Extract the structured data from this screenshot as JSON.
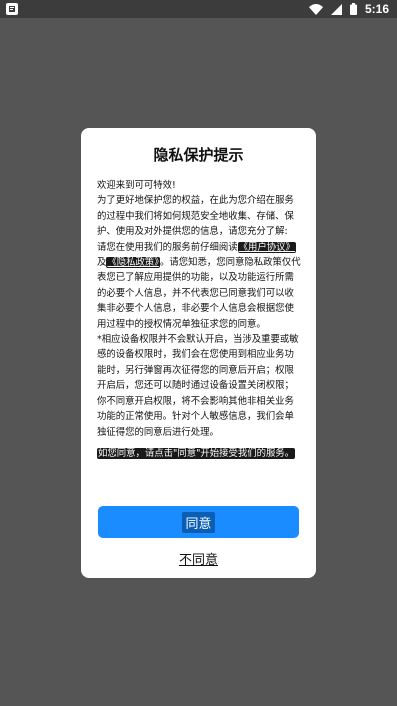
{
  "status_bar": {
    "time": "5:16",
    "icons": [
      "app-notification-icon",
      "wifi-icon",
      "cellular-signal-icon",
      "battery-icon"
    ]
  },
  "dialog": {
    "title": "隐私保护提示",
    "greeting": "欢迎来到可可特效!",
    "para1": "为了更好地保护您的权益，在此为您介绍在服务的过程中我们将如何规范安全地收集、存储、保护、使用及对外提供您的信息，请您充分了解:",
    "para2_prefix": "请您在使用我们的服务前仔细阅读",
    "user_agreement_link": "《用户协议》",
    "para2_and": "及",
    "privacy_policy_link": "《隐私政策》",
    "para2_suffix": "。请您知悉，您同意隐私政策仅代表您已了解应用提供的功能，以及功能运行所需的必要个人信息，并不代表您已同意我们可以收集非必要个人信息，非必要个人信息会根据您使用过程中的授权情况单独征求您的同意。",
    "para3": "*相应设备权限并不会默认开启，当涉及重要或敏感的设备权限时，我们会在您使用到相应业务功能时，另行弹窗再次征得您的同意后开启；权限开启后，您还可以随时通过设备设置关闭权限；你不同意开启权限，将不会影响其他非相关业务功能的正常使用。针对个人敏感信息，我们会单独征得您的同意后进行处理。",
    "para4": "如您同意，请点击\"同意\"开始接受我们的服务。",
    "agree_label": "同意",
    "disagree_label": "不同意"
  },
  "colors": {
    "overlay": "#555555",
    "accent": "#1a8cff",
    "dialog_bg": "#ffffff"
  }
}
